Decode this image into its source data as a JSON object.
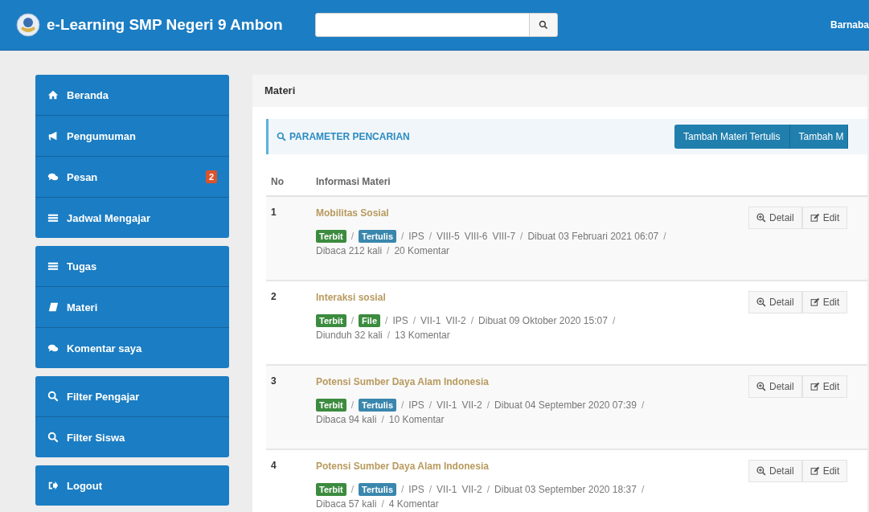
{
  "header": {
    "title": "e-Learning SMP Negeri 9 Ambon",
    "user": "Barnaba"
  },
  "sidebar": {
    "groups": [
      {
        "items": [
          {
            "label": "Beranda"
          },
          {
            "label": "Pengumuman"
          },
          {
            "label": "Pesan",
            "badge": "2"
          },
          {
            "label": "Jadwal Mengajar"
          }
        ]
      },
      {
        "items": [
          {
            "label": "Tugas"
          },
          {
            "label": "Materi"
          },
          {
            "label": "Komentar saya"
          }
        ]
      },
      {
        "items": [
          {
            "label": "Filter Pengajar"
          },
          {
            "label": "Filter Siswa"
          }
        ]
      },
      {
        "items": [
          {
            "label": "Logout"
          }
        ]
      }
    ]
  },
  "panel": {
    "title": "Materi",
    "search_toggle": "PARAMETER PENCARIAN",
    "buttons": [
      "Tambah Materi Tertulis",
      "Tambah M"
    ],
    "table": {
      "columns": [
        "No",
        "Informasi Materi"
      ],
      "rows": [
        {
          "no": "1",
          "title": "Mobilitas Sosial",
          "meta_line_1": [
            {
              "kind": "tag",
              "text": "Terbit",
              "color": "#3c8b3f"
            },
            {
              "kind": "sep",
              "text": "/"
            },
            {
              "kind": "tag",
              "text": "Tertulis",
              "color": "#3a87ad"
            },
            {
              "kind": "sep",
              "text": "/"
            },
            {
              "kind": "text",
              "text": "IPS"
            },
            {
              "kind": "sep",
              "text": "/"
            },
            {
              "kind": "text",
              "text": "VIII-5"
            },
            {
              "kind": "text",
              "text": "VIII-6"
            },
            {
              "kind": "text",
              "text": "VIII-7"
            },
            {
              "kind": "sep",
              "text": "/"
            },
            {
              "kind": "text",
              "text": "Dibuat 03 Februari 2021 06:07"
            },
            {
              "kind": "sep",
              "text": "/"
            }
          ],
          "meta_line_2": [
            {
              "kind": "text",
              "text": "Dibaca 212 kali"
            },
            {
              "kind": "sep",
              "text": "/"
            },
            {
              "kind": "text",
              "text": "20 Komentar"
            }
          ],
          "actions": [
            "Detail",
            "Edit"
          ]
        },
        {
          "no": "2",
          "title": "Interaksi sosial",
          "meta_line_1": [
            {
              "kind": "tag",
              "text": "Terbit",
              "color": "#3c8b3f"
            },
            {
              "kind": "sep",
              "text": "/"
            },
            {
              "kind": "tag",
              "text": "File",
              "color": "#3c8b3f"
            },
            {
              "kind": "sep",
              "text": "/"
            },
            {
              "kind": "text",
              "text": "IPS"
            },
            {
              "kind": "sep",
              "text": "/"
            },
            {
              "kind": "text",
              "text": "VII-1"
            },
            {
              "kind": "text",
              "text": "VII-2"
            },
            {
              "kind": "sep",
              "text": "/"
            },
            {
              "kind": "text",
              "text": "Dibuat 09 Oktober 2020 15:07"
            },
            {
              "kind": "sep",
              "text": "/"
            }
          ],
          "meta_line_2": [
            {
              "kind": "text",
              "text": "Diunduh 32 kali"
            },
            {
              "kind": "sep",
              "text": "/"
            },
            {
              "kind": "text",
              "text": "13 Komentar"
            }
          ],
          "actions": [
            "Detail",
            "Edit"
          ]
        },
        {
          "no": "3",
          "title": "Potensi Sumber Daya Alam Indonesia",
          "meta_line_1": [
            {
              "kind": "tag",
              "text": "Terbit",
              "color": "#3c8b3f"
            },
            {
              "kind": "sep",
              "text": "/"
            },
            {
              "kind": "tag",
              "text": "Tertulis",
              "color": "#3a87ad"
            },
            {
              "kind": "sep",
              "text": "/"
            },
            {
              "kind": "text",
              "text": "IPS"
            },
            {
              "kind": "sep",
              "text": "/"
            },
            {
              "kind": "text",
              "text": "VII-1"
            },
            {
              "kind": "text",
              "text": "VII-2"
            },
            {
              "kind": "sep",
              "text": "/"
            },
            {
              "kind": "text",
              "text": "Dibuat 04 September 2020 07:39"
            },
            {
              "kind": "sep",
              "text": "/"
            }
          ],
          "meta_line_2": [
            {
              "kind": "text",
              "text": "Dibaca 94 kali"
            },
            {
              "kind": "sep",
              "text": "/"
            },
            {
              "kind": "text",
              "text": "10 Komentar"
            }
          ],
          "actions": [
            "Detail",
            "Edit"
          ]
        },
        {
          "no": "4",
          "title": "Potensi Sumber Daya Alam Indonesia",
          "meta_line_1": [
            {
              "kind": "tag",
              "text": "Terbit",
              "color": "#3c8b3f"
            },
            {
              "kind": "sep",
              "text": "/"
            },
            {
              "kind": "tag",
              "text": "Tertulis",
              "color": "#3a87ad"
            },
            {
              "kind": "sep",
              "text": "/"
            },
            {
              "kind": "text",
              "text": "IPS"
            },
            {
              "kind": "sep",
              "text": "/"
            },
            {
              "kind": "text",
              "text": "VII-1"
            },
            {
              "kind": "text",
              "text": "VII-2"
            },
            {
              "kind": "sep",
              "text": "/"
            },
            {
              "kind": "text",
              "text": "Dibuat 03 September 2020 18:37"
            },
            {
              "kind": "sep",
              "text": "/"
            }
          ],
          "meta_line_2": [
            {
              "kind": "text",
              "text": "Dibaca 57 kali"
            },
            {
              "kind": "sep",
              "text": "/"
            },
            {
              "kind": "text",
              "text": "4 Komentar"
            }
          ],
          "actions": [
            "Detail",
            "Edit"
          ]
        }
      ]
    }
  }
}
